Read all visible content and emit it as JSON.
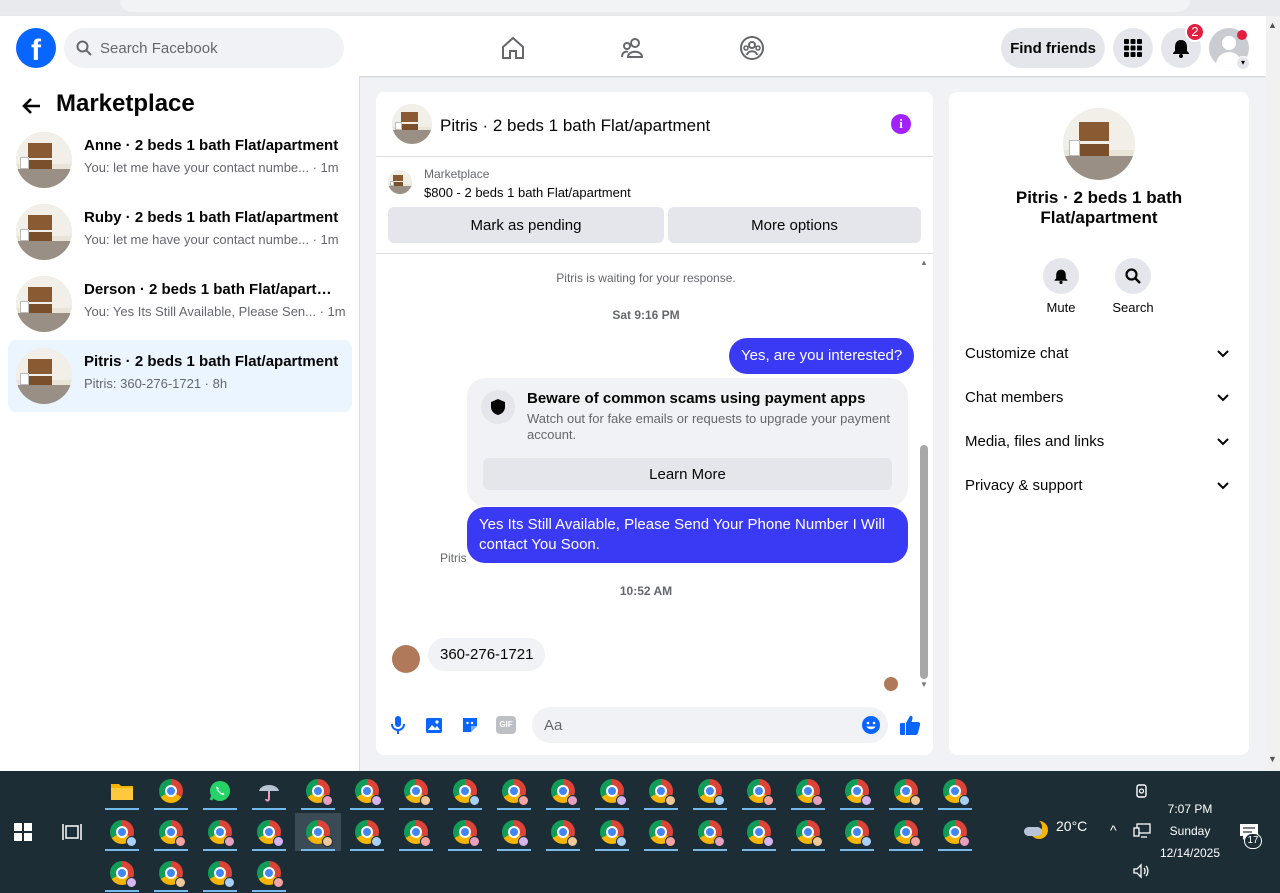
{
  "top_nav": {
    "search_placeholder": "Search Facebook",
    "find_friends_label": "Find friends",
    "notification_count": "2",
    "logo_letter": "f"
  },
  "sidebar": {
    "title": "Marketplace",
    "conversations": [
      {
        "name": "Anne · 2 beds 1 bath Flat/apartment",
        "preview": "You: let me have your contact numbe... · 1m",
        "active": false
      },
      {
        "name": "Ruby · 2 beds 1 bath Flat/apartment",
        "preview": "You: let me have your contact numbe... · 1m",
        "active": false
      },
      {
        "name": "Derson · 2 beds 1 bath Flat/apartm...",
        "preview": "You: Yes Its Still Available, Please Sen... · 1m",
        "active": false
      },
      {
        "name": "Pitris · 2 beds 1 bath Flat/apartment",
        "preview": "Pitris: 360-276-1721 · 8h",
        "active": true
      }
    ]
  },
  "chat": {
    "title": "Pitris · 2 beds 1 bath Flat/apartment",
    "listing_label": "Marketplace",
    "listing_price": "$800 - 2 beds 1 bath Flat/apartment",
    "mark_pending_label": "Mark as pending",
    "more_options_label": "More options",
    "waiting_text": "Pitris is waiting for your response.",
    "timestamp_1": "Sat 9:16 PM",
    "msg_out_1": "Yes, are you interested?",
    "warning_title": "Beware of common scams using payment apps",
    "warning_text": "Watch out for fake emails or requests to upgrade your payment account.",
    "learn_more_label": "Learn More",
    "msg_out_2": "Yes Its Still Available, Please Send Your Phone Number I Will contact You Soon.",
    "timestamp_2": "10:52 AM",
    "sender_name": "Pitris",
    "msg_in_1": "360-276-1721",
    "composer_placeholder": "Aa",
    "gif_label": "GIF"
  },
  "right_panel": {
    "title": "Pitris · 2 beds 1 bath Flat/apartment",
    "actions": [
      {
        "label": "Mute",
        "icon": "bell-icon"
      },
      {
        "label": "Search",
        "icon": "search-icon"
      }
    ],
    "sections": [
      "Customize chat",
      "Chat members",
      "Media, files and links",
      "Privacy & support"
    ]
  },
  "taskbar": {
    "weather_temp": "20°C",
    "time": "7:07 PM",
    "day": "Sunday",
    "date": "12/14/2025",
    "notification_count": "17"
  },
  "colors": {
    "brand_blue": "#0866ff",
    "message_blue": "#3a3af5",
    "info_purple": "#a121ff",
    "taskbar_bg": "#1d2d36"
  }
}
